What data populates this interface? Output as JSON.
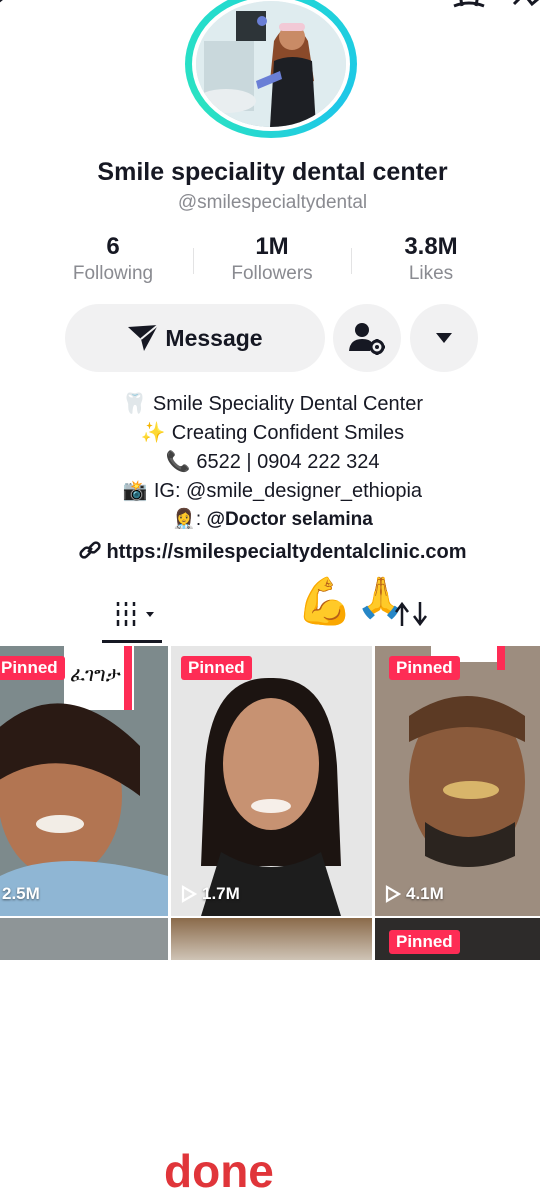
{
  "profile": {
    "name": "Smile speciality dental center",
    "handle": "@smilespecialtydental"
  },
  "stats": [
    {
      "value": "6",
      "label": "Following"
    },
    {
      "value": "1M",
      "label": "Followers"
    },
    {
      "value": "3.8M",
      "label": "Likes"
    }
  ],
  "actions": {
    "message_label": "Message"
  },
  "bio": {
    "line1": "Smile Speciality Dental Center",
    "line2": "Creating Confident Smiles",
    "line3": "6522 | 0904 222 324",
    "line4": "IG: @smile_designer_ethiopia",
    "line5_prefix": ": ",
    "line5": "@Doctor selamina",
    "link": "https://smilespecialtydentalclinic.com"
  },
  "overlay_text": "done",
  "videos": [
    {
      "pinned_label": "Pinned",
      "views": "2.5M",
      "caption": "ፈገግታ"
    },
    {
      "pinned_label": "Pinned",
      "views": "1.7M"
    },
    {
      "pinned_label": "Pinned",
      "views": "4.1M"
    }
  ],
  "colors": {
    "accent": "#fe2c55",
    "ring": "#21d8d3",
    "done": "#e0353a"
  }
}
